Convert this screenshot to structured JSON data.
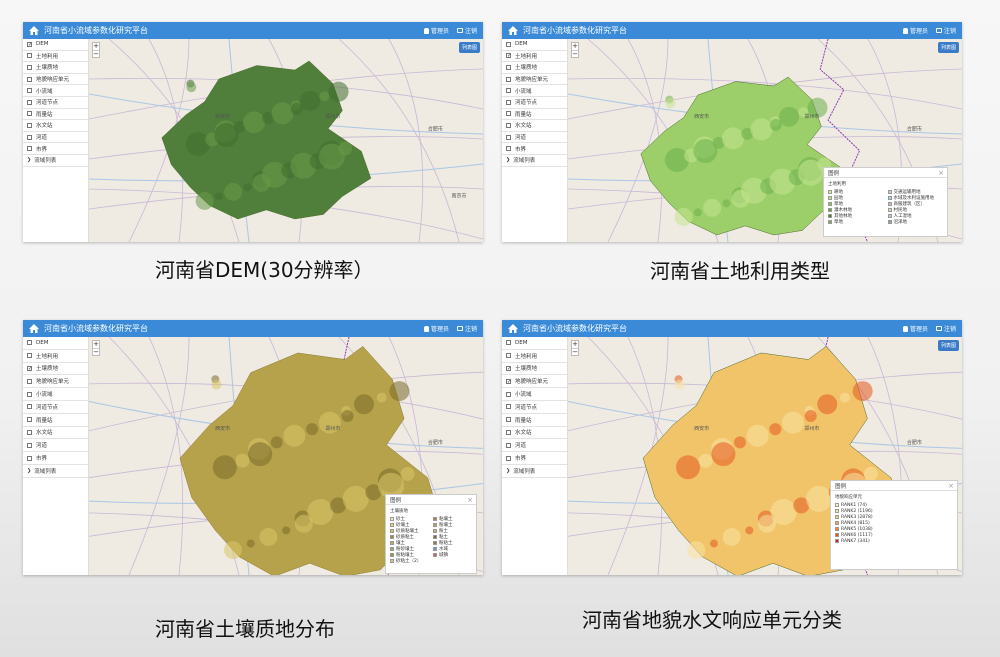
{
  "app": {
    "title": "河南省小流域参数化研究平台",
    "user_label": "管理员",
    "logout_label": "注销",
    "list_button": "列表图"
  },
  "zoom": {
    "in": "+",
    "out": "−"
  },
  "sidebar": {
    "items": [
      "DEM",
      "土地利用",
      "土壤质地",
      "地貌响应单元",
      "小流域",
      "河道节点",
      "雨量站",
      "水文站",
      "河道",
      "市界"
    ],
    "group_label": "流域列表"
  },
  "panels": [
    {
      "id": "p1",
      "checked": [
        0
      ],
      "caption": "河南省DEM(30分辨率）"
    },
    {
      "id": "p2",
      "checked": [
        1
      ],
      "caption": "河南省土地利用类型"
    },
    {
      "id": "p3",
      "checked": [
        2
      ],
      "caption": "河南省土壤质地分布"
    },
    {
      "id": "p4",
      "checked": [
        2,
        3
      ],
      "caption": "河南省地貌水文响应单元分类"
    }
  ],
  "legends": {
    "title": "图例",
    "close": "×",
    "landuse": {
      "subtitle": "土地利用",
      "items": [
        {
          "label": "耕地",
          "color": "#d9ec9a"
        },
        {
          "label": "交通运输用地",
          "color": "#c8c8c8"
        },
        {
          "label": "园地",
          "color": "#b6e07b"
        },
        {
          "label": "水域及水利设施用地",
          "color": "#9fd2ec"
        },
        {
          "label": "草地",
          "color": "#8cc34a"
        },
        {
          "label": "商服建筑（区）",
          "color": "#e0b0b0"
        },
        {
          "label": "灌木林地",
          "color": "#5fa53a"
        },
        {
          "label": "村民地",
          "color": "#d9d9b0"
        },
        {
          "label": "其他林地",
          "color": "#3e8a2e"
        },
        {
          "label": "人工湿地",
          "color": "#aad4d4"
        },
        {
          "label": "草地",
          "color": "#77b648"
        },
        {
          "label": "沼泽地",
          "color": "#88a3a3"
        }
      ]
    },
    "soil": {
      "subtitle": "土壤质地",
      "items": [
        {
          "label": "砂土",
          "color": "#f0e8b8"
        },
        {
          "label": "粘壤土",
          "color": "#a8823a"
        },
        {
          "label": "砂壤土",
          "color": "#e6d27a"
        },
        {
          "label": "粉壤土",
          "color": "#b4a050"
        },
        {
          "label": "砂质粘壤土",
          "color": "#d8c060"
        },
        {
          "label": "粉土",
          "color": "#c8b468"
        },
        {
          "label": "砂质粘土",
          "color": "#9c8a3a"
        },
        {
          "label": "粘土",
          "color": "#7a6a3a"
        },
        {
          "label": "壤土",
          "color": "#c0b050"
        },
        {
          "label": "粉粘土",
          "color": "#8a7a48"
        },
        {
          "label": "粉砂壤土",
          "color": "#b0a060"
        },
        {
          "label": "水域",
          "color": "#6aa0d0"
        },
        {
          "label": "粉粘壤土",
          "color": "#a09040"
        },
        {
          "label": "城镇",
          "color": "#c06060"
        },
        {
          "label": "砂粘土（2）",
          "color": "#d8c88a"
        }
      ]
    },
    "hru": {
      "subtitle": "地貌响应单元",
      "items": [
        {
          "label": "RANK1 (74)",
          "color": "#fbf6c8"
        },
        {
          "label": "RANK2 (1196)",
          "color": "#f5e89a"
        },
        {
          "label": "RANK3 (2878)",
          "color": "#f4d070"
        },
        {
          "label": "RANK4 (815)",
          "color": "#f3a848"
        },
        {
          "label": "RANK5 (1038)",
          "color": "#ee8030"
        },
        {
          "label": "RANK6 (1117)",
          "color": "#e45020"
        },
        {
          "label": "RANK7 (341)",
          "color": "#c82010"
        }
      ]
    }
  },
  "map_labels": [
    "西安市",
    "郑州市",
    "合肥市",
    "南京市"
  ],
  "colors": {
    "topbar": "#3a8ad7",
    "dem": "#4f7f3a",
    "landuse": "#9ccf6a",
    "soil": "#b5a24a",
    "hru": "#f2c46a",
    "boundary": "#8a3ab0"
  }
}
